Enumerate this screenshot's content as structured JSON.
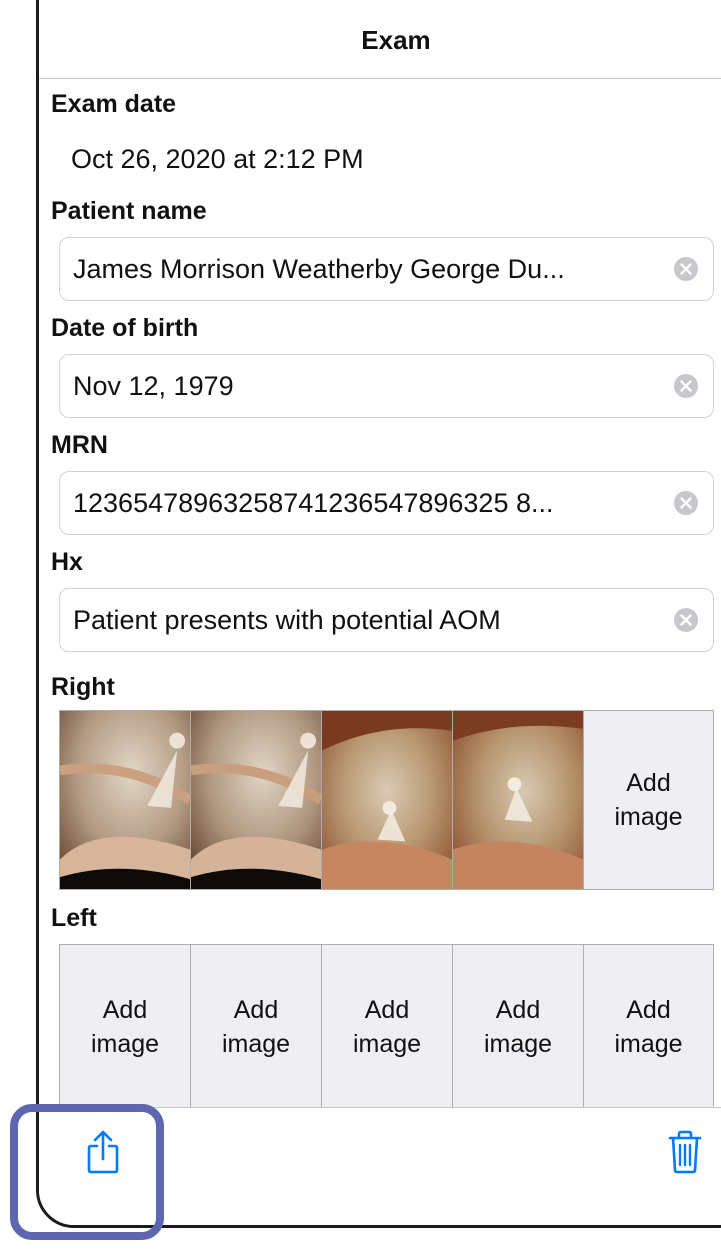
{
  "header": {
    "title": "Exam"
  },
  "exam_date": {
    "label": "Exam date",
    "value": "Oct 26, 2020 at 2:12 PM"
  },
  "patient_name": {
    "label": "Patient name",
    "value": "James Morrison Weatherby George Du..."
  },
  "date_of_birth": {
    "label": "Date of birth",
    "value": "Nov 12, 1979"
  },
  "mrn": {
    "label": "MRN",
    "value": "12365478963258741236547896325 8..."
  },
  "hx": {
    "label": "Hx",
    "value": "Patient presents with potential AOM"
  },
  "right": {
    "label": "Right",
    "images": [
      "ear-exam-image",
      "ear-exam-image",
      "ear-exam-image",
      "ear-exam-image"
    ],
    "add_label": "Add image"
  },
  "left": {
    "label": "Left",
    "cells": [
      "Add image",
      "Add image",
      "Add image",
      "Add image",
      "Add image"
    ]
  },
  "toolbar": {
    "share_icon": "share-icon",
    "delete_icon": "trash-icon"
  },
  "colors": {
    "accent": "#007aff",
    "highlight": "#5d66ae",
    "add_cell_bg": "#eeeef3"
  }
}
